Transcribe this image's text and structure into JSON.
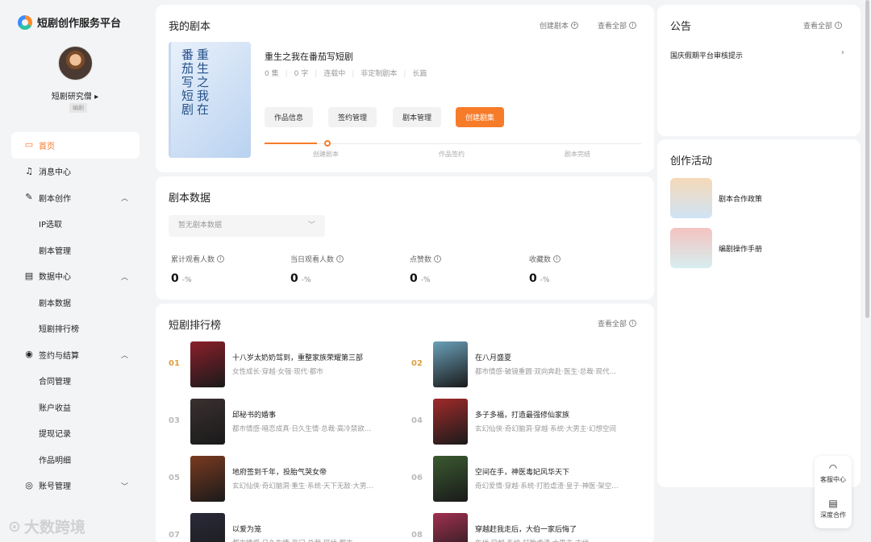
{
  "brand": {
    "name": "短剧创作服务平台"
  },
  "user": {
    "name": "短剧研究僧 ▸",
    "tag": "编剧"
  },
  "nav": [
    {
      "label": "首页",
      "icon": "monitor-icon",
      "glyph": "▭",
      "active": true
    },
    {
      "label": "消息中心",
      "icon": "bell-icon",
      "glyph": "♫"
    },
    {
      "label": "剧本创作",
      "icon": "pen-icon",
      "glyph": "✎",
      "chevron": "︿"
    },
    {
      "label": "IP选取",
      "sub": true
    },
    {
      "label": "剧本管理",
      "sub": true
    },
    {
      "label": "数据中心",
      "icon": "chart-icon",
      "glyph": "▤",
      "chevron": "︿"
    },
    {
      "label": "剧本数据",
      "sub": true
    },
    {
      "label": "短剧排行榜",
      "sub": true
    },
    {
      "label": "签约与结算",
      "icon": "coin-icon",
      "glyph": "◉",
      "chevron": "︿"
    },
    {
      "label": "合同管理",
      "sub": true
    },
    {
      "label": "账户收益",
      "sub": true
    },
    {
      "label": "提现记录",
      "sub": true
    },
    {
      "label": "作品明细",
      "sub": true
    },
    {
      "label": "账号管理",
      "icon": "account-icon",
      "glyph": "◎",
      "chevron": "﹀"
    }
  ],
  "my_script": {
    "title": "我的剧本",
    "create_link": "创建剧本",
    "view_all": "查看全部",
    "cover_text": "重生之我在番茄写短剧",
    "script_title": "重生之我在番茄写短剧",
    "meta": [
      "0 集",
      "0 字",
      "连载中",
      "非定制剧本",
      "长篇"
    ],
    "buttons": [
      "作品信息",
      "签约管理",
      "剧本管理",
      "创建剧集"
    ],
    "progress": 0.14,
    "steps": [
      "创建剧本",
      "作品签约",
      "剧本完结"
    ]
  },
  "script_data": {
    "title": "剧本数据",
    "select_placeholder": "暂无剧本数据",
    "stats": [
      {
        "label": "累计观看人数",
        "value": "0",
        "change": "-%"
      },
      {
        "label": "当日观看人数",
        "value": "0",
        "change": "-%"
      },
      {
        "label": "点赞数",
        "value": "0",
        "change": "-%"
      },
      {
        "label": "收藏数",
        "value": "0",
        "change": "-%"
      }
    ]
  },
  "ranking": {
    "title": "短剧排行榜",
    "view_all": "查看全部",
    "items": [
      {
        "rank": "01",
        "title": "十八岁太奶奶驾到，重整家族荣耀第三部",
        "tags": "女性成长·穿越·女强·现代·都市",
        "color": "#8a1f2a"
      },
      {
        "rank": "02",
        "title": "在八月盛夏",
        "tags": "都市情感·破镜重圆·双向奔赴·医生·总裁·现代…",
        "color": "#6aa0b8"
      },
      {
        "rank": "03",
        "title": "邱秘书的婚事",
        "tags": "都市情感·暗恋成真·日久生情·总裁·高冷禁欲…",
        "color": "#3a3030"
      },
      {
        "rank": "04",
        "title": "多子多福，打造最强修仙家族",
        "tags": "玄幻仙侠·奇幻脑洞·穿越·系统·大男主·幻想空间",
        "color": "#a02a2a"
      },
      {
        "rank": "05",
        "title": "地府签到千年，投胎气哭女帝",
        "tags": "玄幻仙侠·奇幻脑洞·重生·系统·天下无敌·大男…",
        "color": "#7a3a20"
      },
      {
        "rank": "06",
        "title": "空间在手，神医毒妃风华天下",
        "tags": "奇幻爱情·穿越·系统·打脸虐渣·皇子·神医·架空…",
        "color": "#3a5a30"
      },
      {
        "rank": "07",
        "title": "以爱为笼",
        "tags": "都市情感·日久生情·豪门·总裁·现代·都市",
        "color": "#2a2a3a"
      },
      {
        "rank": "08",
        "title": "穿越赶我走后，大伯一家后悔了",
        "tags": "年代·穿越·系统·打脸虐渣·大男主·古代",
        "color": "#a03050"
      }
    ]
  },
  "notice": {
    "title": "公告",
    "view_all": "查看全部",
    "items": [
      "国庆假期平台审核提示"
    ]
  },
  "activity": {
    "title": "创作活动",
    "items": [
      {
        "label": "剧本合作政策",
        "color": "#f6d9b8"
      },
      {
        "label": "编剧操作手册",
        "color": "#f3c3c0"
      }
    ]
  },
  "float": [
    {
      "label": "客服中心",
      "icon": "headset-icon",
      "glyph": "◠"
    },
    {
      "label": "深度合作",
      "icon": "document-icon",
      "glyph": "▤"
    }
  ],
  "watermark": "大数跨境"
}
